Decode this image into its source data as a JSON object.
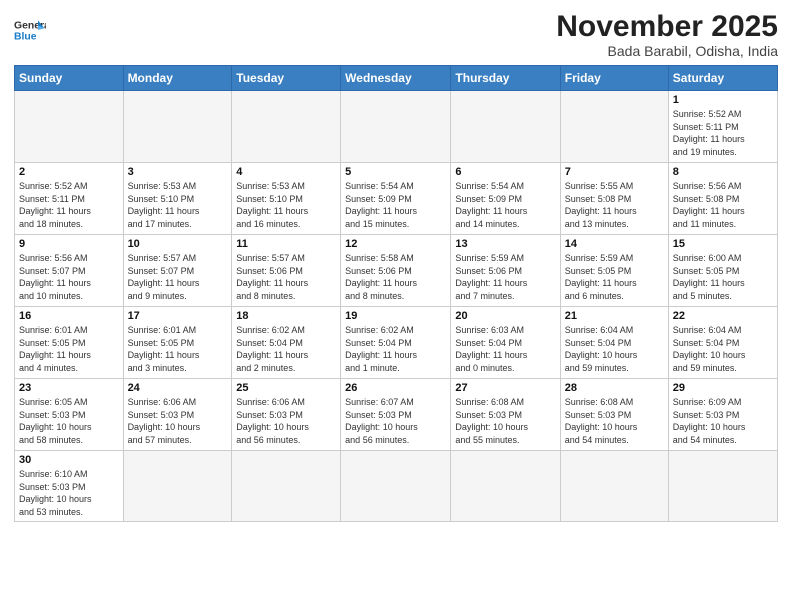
{
  "logo": {
    "text_general": "General",
    "text_blue": "Blue"
  },
  "header": {
    "month_title": "November 2025",
    "subtitle": "Bada Barabil, Odisha, India"
  },
  "weekdays": [
    "Sunday",
    "Monday",
    "Tuesday",
    "Wednesday",
    "Thursday",
    "Friday",
    "Saturday"
  ],
  "weeks": [
    [
      {
        "day": "",
        "info": ""
      },
      {
        "day": "",
        "info": ""
      },
      {
        "day": "",
        "info": ""
      },
      {
        "day": "",
        "info": ""
      },
      {
        "day": "",
        "info": ""
      },
      {
        "day": "",
        "info": ""
      },
      {
        "day": "1",
        "info": "Sunrise: 5:52 AM\nSunset: 5:11 PM\nDaylight: 11 hours\nand 19 minutes."
      }
    ],
    [
      {
        "day": "2",
        "info": "Sunrise: 5:52 AM\nSunset: 5:11 PM\nDaylight: 11 hours\nand 18 minutes."
      },
      {
        "day": "3",
        "info": "Sunrise: 5:53 AM\nSunset: 5:10 PM\nDaylight: 11 hours\nand 17 minutes."
      },
      {
        "day": "4",
        "info": "Sunrise: 5:53 AM\nSunset: 5:10 PM\nDaylight: 11 hours\nand 16 minutes."
      },
      {
        "day": "5",
        "info": "Sunrise: 5:54 AM\nSunset: 5:09 PM\nDaylight: 11 hours\nand 15 minutes."
      },
      {
        "day": "6",
        "info": "Sunrise: 5:54 AM\nSunset: 5:09 PM\nDaylight: 11 hours\nand 14 minutes."
      },
      {
        "day": "7",
        "info": "Sunrise: 5:55 AM\nSunset: 5:08 PM\nDaylight: 11 hours\nand 13 minutes."
      },
      {
        "day": "8",
        "info": "Sunrise: 5:56 AM\nSunset: 5:08 PM\nDaylight: 11 hours\nand 11 minutes."
      }
    ],
    [
      {
        "day": "9",
        "info": "Sunrise: 5:56 AM\nSunset: 5:07 PM\nDaylight: 11 hours\nand 10 minutes."
      },
      {
        "day": "10",
        "info": "Sunrise: 5:57 AM\nSunset: 5:07 PM\nDaylight: 11 hours\nand 9 minutes."
      },
      {
        "day": "11",
        "info": "Sunrise: 5:57 AM\nSunset: 5:06 PM\nDaylight: 11 hours\nand 8 minutes."
      },
      {
        "day": "12",
        "info": "Sunrise: 5:58 AM\nSunset: 5:06 PM\nDaylight: 11 hours\nand 8 minutes."
      },
      {
        "day": "13",
        "info": "Sunrise: 5:59 AM\nSunset: 5:06 PM\nDaylight: 11 hours\nand 7 minutes."
      },
      {
        "day": "14",
        "info": "Sunrise: 5:59 AM\nSunset: 5:05 PM\nDaylight: 11 hours\nand 6 minutes."
      },
      {
        "day": "15",
        "info": "Sunrise: 6:00 AM\nSunset: 5:05 PM\nDaylight: 11 hours\nand 5 minutes."
      }
    ],
    [
      {
        "day": "16",
        "info": "Sunrise: 6:01 AM\nSunset: 5:05 PM\nDaylight: 11 hours\nand 4 minutes."
      },
      {
        "day": "17",
        "info": "Sunrise: 6:01 AM\nSunset: 5:05 PM\nDaylight: 11 hours\nand 3 minutes."
      },
      {
        "day": "18",
        "info": "Sunrise: 6:02 AM\nSunset: 5:04 PM\nDaylight: 11 hours\nand 2 minutes."
      },
      {
        "day": "19",
        "info": "Sunrise: 6:02 AM\nSunset: 5:04 PM\nDaylight: 11 hours\nand 1 minute."
      },
      {
        "day": "20",
        "info": "Sunrise: 6:03 AM\nSunset: 5:04 PM\nDaylight: 11 hours\nand 0 minutes."
      },
      {
        "day": "21",
        "info": "Sunrise: 6:04 AM\nSunset: 5:04 PM\nDaylight: 10 hours\nand 59 minutes."
      },
      {
        "day": "22",
        "info": "Sunrise: 6:04 AM\nSunset: 5:04 PM\nDaylight: 10 hours\nand 59 minutes."
      }
    ],
    [
      {
        "day": "23",
        "info": "Sunrise: 6:05 AM\nSunset: 5:03 PM\nDaylight: 10 hours\nand 58 minutes."
      },
      {
        "day": "24",
        "info": "Sunrise: 6:06 AM\nSunset: 5:03 PM\nDaylight: 10 hours\nand 57 minutes."
      },
      {
        "day": "25",
        "info": "Sunrise: 6:06 AM\nSunset: 5:03 PM\nDaylight: 10 hours\nand 56 minutes."
      },
      {
        "day": "26",
        "info": "Sunrise: 6:07 AM\nSunset: 5:03 PM\nDaylight: 10 hours\nand 56 minutes."
      },
      {
        "day": "27",
        "info": "Sunrise: 6:08 AM\nSunset: 5:03 PM\nDaylight: 10 hours\nand 55 minutes."
      },
      {
        "day": "28",
        "info": "Sunrise: 6:08 AM\nSunset: 5:03 PM\nDaylight: 10 hours\nand 54 minutes."
      },
      {
        "day": "29",
        "info": "Sunrise: 6:09 AM\nSunset: 5:03 PM\nDaylight: 10 hours\nand 54 minutes."
      }
    ],
    [
      {
        "day": "30",
        "info": "Sunrise: 6:10 AM\nSunset: 5:03 PM\nDaylight: 10 hours\nand 53 minutes."
      },
      {
        "day": "",
        "info": ""
      },
      {
        "day": "",
        "info": ""
      },
      {
        "day": "",
        "info": ""
      },
      {
        "day": "",
        "info": ""
      },
      {
        "day": "",
        "info": ""
      },
      {
        "day": "",
        "info": ""
      }
    ]
  ]
}
